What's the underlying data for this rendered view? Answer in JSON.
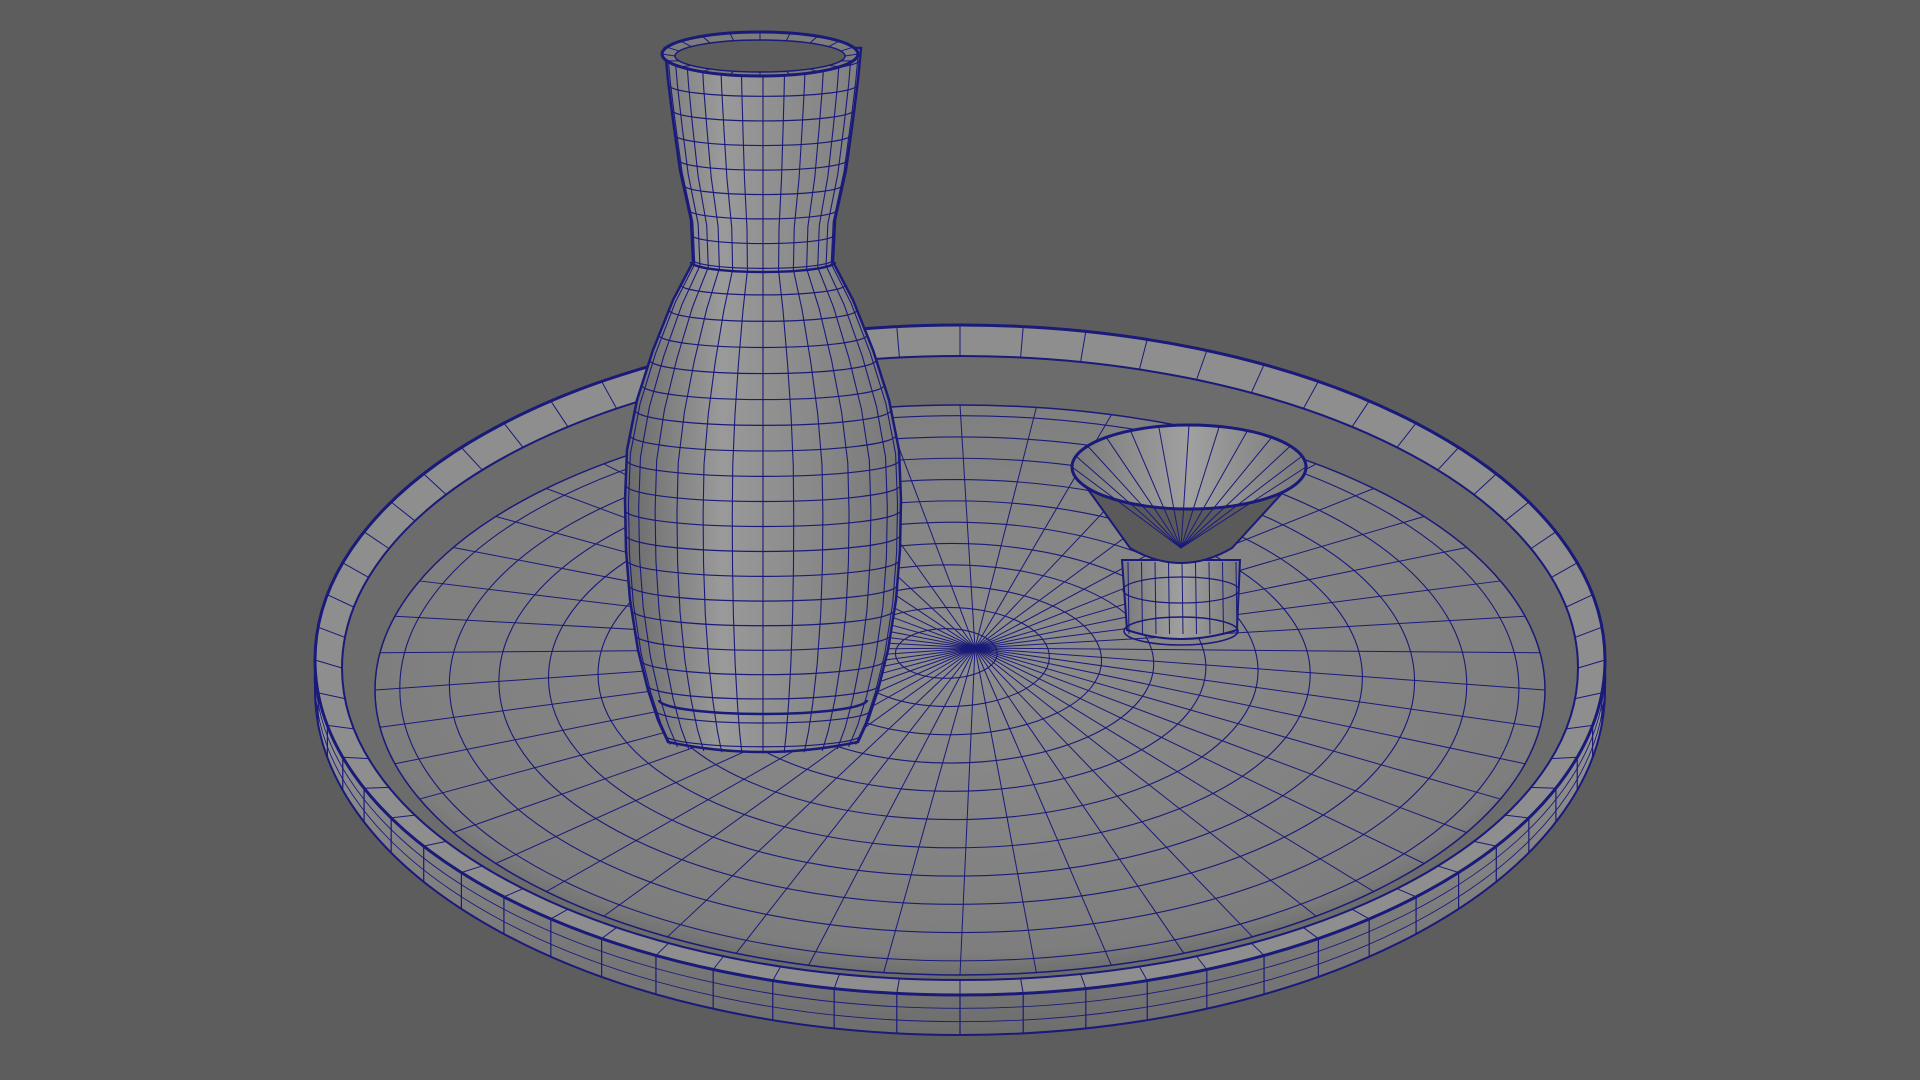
{
  "viewport": {
    "background_color": "#5d5d5d",
    "wireframe_color": "#1a1a7a",
    "surface_color": "#8a8a8a"
  },
  "scene": {
    "objects": [
      {
        "name": "sake-tray",
        "shape": "shallow round tray with rim"
      },
      {
        "name": "sake-bottle",
        "shape": "tokkuri bottle"
      },
      {
        "name": "sake-cup",
        "shape": "ochoko cup on foot"
      }
    ]
  }
}
